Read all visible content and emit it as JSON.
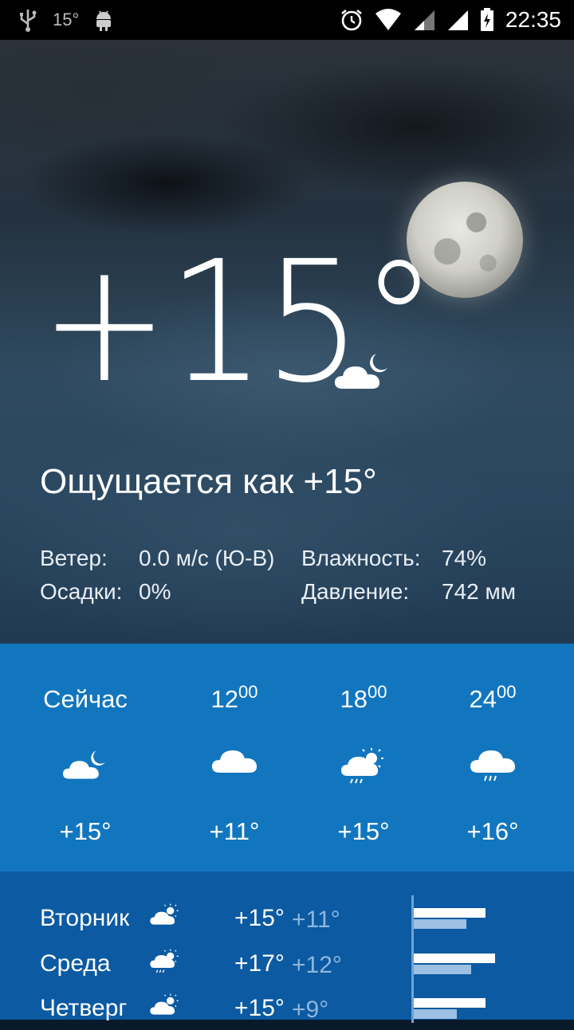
{
  "status_bar": {
    "temp": "15°",
    "time": "22:35",
    "icons": [
      "usb-icon",
      "android-icon",
      "alarm-icon",
      "wifi-icon",
      "signal-icon",
      "signal-icon",
      "battery-charging-icon"
    ]
  },
  "current": {
    "temperature": "+15°",
    "condition_icon": "partly-cloudy-night-icon",
    "feels_like": "Ощущается как +15°",
    "details": {
      "wind_label": "Ветер:",
      "wind_value": "0.0 м/с (Ю-В)",
      "precip_label": "Осадки:",
      "precip_value": "0%",
      "humidity_label": "Влажность:",
      "humidity_value": "74%",
      "pressure_label": "Давление:",
      "pressure_value": "742 мм"
    }
  },
  "hourly": [
    {
      "time": "Сейчас",
      "time_sup": "",
      "icon": "partly-cloudy-night-icon",
      "temp": "+15°"
    },
    {
      "time": "12",
      "time_sup": "00",
      "icon": "cloud-icon",
      "temp": "+11°"
    },
    {
      "time": "18",
      "time_sup": "00",
      "icon": "partly-cloudy-rain-icon",
      "temp": "+15°"
    },
    {
      "time": "24",
      "time_sup": "00",
      "icon": "cloud-rain-icon",
      "temp": "+16°"
    }
  ],
  "daily": [
    {
      "day": "Вторник",
      "icon": "partly-cloudy-day-icon",
      "high": "+15°",
      "low": "+11°",
      "high_value": 15,
      "low_value": 11
    },
    {
      "day": "Среда",
      "icon": "partly-cloudy-rain-icon",
      "high": "+17°",
      "low": "+12°",
      "high_value": 17,
      "low_value": 12
    },
    {
      "day": "Четверг",
      "icon": "partly-cloudy-day-icon",
      "high": "+15°",
      "low": "+9°",
      "high_value": 15,
      "low_value": 9
    }
  ],
  "colors": {
    "hourly_bg": "#1276bf",
    "daily_bg": "#0b5aa2",
    "low_temp": "#8fb6dc"
  }
}
